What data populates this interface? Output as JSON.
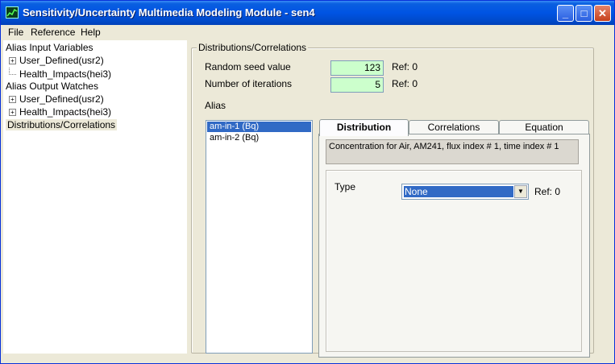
{
  "window": {
    "title": "Sensitivity/Uncertainty Multimedia Modeling Module - sen4",
    "min_glyph": "_",
    "max_glyph": "□",
    "close_glyph": "✕"
  },
  "menu": {
    "file": "File",
    "reference": "Reference",
    "help": "Help"
  },
  "tree": {
    "input_vars": "Alias Input Variables",
    "input_user_defined": "User_Defined(usr2)",
    "input_health_impacts": "Health_Impacts(hei3)",
    "output_watches": "Alias Output Watches",
    "output_user_defined": "User_Defined(usr2)",
    "output_health_impacts": "Health_Impacts(hei3)",
    "distributions": "Distributions/Correlations",
    "expand_glyph": "+"
  },
  "group": {
    "label": "Distributions/Correlations"
  },
  "seed": {
    "label": "Random seed value",
    "value": "123",
    "ref": "Ref:  0"
  },
  "iterations": {
    "label": "Number of iterations",
    "value": "5",
    "ref": "Ref:  0"
  },
  "alias": {
    "label": "Alias",
    "items": [
      "am-in-1  (Bq)",
      "am-in-2  (Bq)"
    ]
  },
  "tabs": {
    "distribution": "Distribution",
    "correlations": "Correlations",
    "equation": "Equation"
  },
  "distribution_page": {
    "description": "Concentration for Air, AM241, flux index # 1, time index # 1",
    "type_label": "Type",
    "type_value": "None",
    "type_ref": "Ref: 0",
    "dropdown_glyph": "▼"
  },
  "colors": {
    "title_bar": "#0054e3",
    "field_bg": "#ccffcc",
    "selection": "#316ac5"
  }
}
